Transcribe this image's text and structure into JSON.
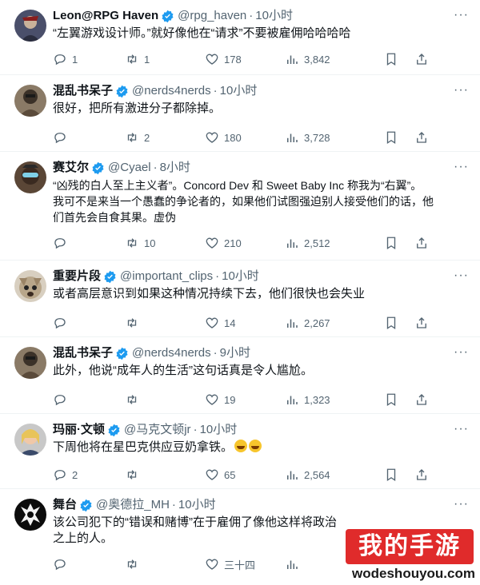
{
  "tweets": [
    {
      "name": "Leon@RPG Haven",
      "handle": "@rpg_haven",
      "time": "10小时",
      "text": "“左翼游戏设计师。”就好像他在“请求”不要被雇佣哈哈哈哈",
      "replies": "1",
      "retweets": "1",
      "likes": "178",
      "views": "3,842"
    },
    {
      "name": "混乱书呆子",
      "handle": "@nerds4nerds",
      "time": "10小时",
      "text": "很好，把所有激进分子都除掉。",
      "replies": "",
      "retweets": "2",
      "likes": "180",
      "views": "3,728"
    },
    {
      "name": "赛艾尔",
      "handle": "@Cyael",
      "time": "8小时",
      "text": "“凶残的白人至上主义者”。Concord Dev 和 Sweet Baby Inc 称我为“右翼”。\n我可不是来当一个愚蠢的争论者的，如果他们试图强迫别人接受他们的话，他\n们首先会自食其果。虚伪",
      "replies": "",
      "retweets": "10",
      "likes": "210",
      "views": "2,512"
    },
    {
      "name": "重要片段",
      "handle": "@important_clips",
      "time": "10小时",
      "text": "或者高层意识到如果这种情况持续下去，他们很快也会失业",
      "replies": "",
      "retweets": "",
      "likes": "14",
      "views": "2,267"
    },
    {
      "name": "混乱书呆子",
      "handle": "@nerds4nerds",
      "time": "9小时",
      "text": "此外，他说“成年人的生活”这句话真是令人尴尬。",
      "replies": "",
      "retweets": "",
      "likes": "19",
      "views": "1,323"
    },
    {
      "name": "玛丽·文顿",
      "handle": "@马克文顿jr",
      "time": "10小时",
      "text": "下周他将在星巴克供应豆奶拿铁。",
      "replies": "2",
      "retweets": "",
      "likes": "65",
      "views": "2,564"
    },
    {
      "name": "舞台",
      "handle": "@奥德拉_MH",
      "time": "10小时",
      "text": "该公司犯下的“错误和赌博”在于雇佣了像他这样将政治\n之上的人。",
      "replies": "",
      "retweets": "",
      "likes": "三十四",
      "views": ""
    }
  ],
  "dot": "·",
  "more": "···",
  "watermark": {
    "title": "我的手游",
    "url": "wodeshouyou.com"
  },
  "colors": {
    "verified": "#1d9bf0",
    "muted": "#536471",
    "watermark_red": "#e02b2b"
  }
}
